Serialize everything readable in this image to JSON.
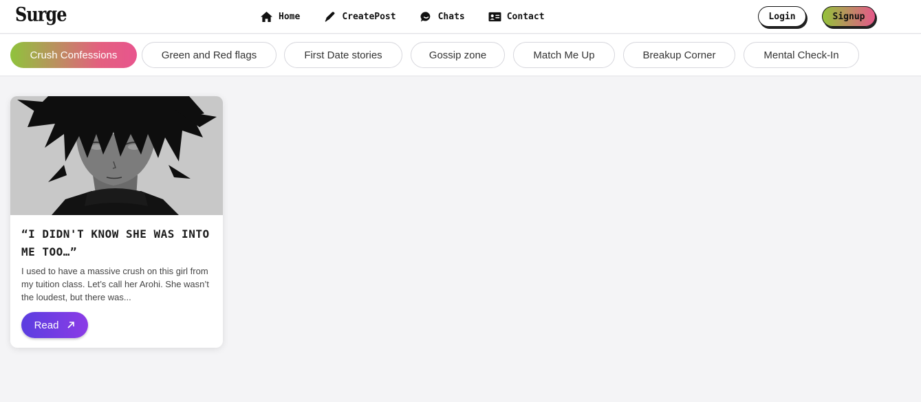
{
  "brand": {
    "name": "Surge"
  },
  "nav": {
    "links": [
      {
        "label": "Home",
        "icon": "home-icon"
      },
      {
        "label": "CreatePost",
        "icon": "pen-icon"
      },
      {
        "label": "Chats",
        "icon": "chat-icon"
      },
      {
        "label": "Contact",
        "icon": "contact-card-icon"
      }
    ],
    "login_label": "Login",
    "signup_label": "Signup"
  },
  "categories": [
    {
      "label": "Crush Confessions",
      "active": true
    },
    {
      "label": "Green and Red flags",
      "active": false
    },
    {
      "label": "First Date stories",
      "active": false
    },
    {
      "label": "Gossip zone",
      "active": false
    },
    {
      "label": "Match Me Up",
      "active": false
    },
    {
      "label": "Breakup Corner",
      "active": false
    },
    {
      "label": "Mental Check-In",
      "active": false
    }
  ],
  "posts": [
    {
      "title": "“I DIDN'T KNOW SHE WAS INTO ME TOO…”",
      "excerpt": "I used to have a massive crush on this girl from my tuition class. Let’s call her Arohi. She wasn’t the loudest, but there was...",
      "read_label": "Read",
      "image": "anime-boy-portrait"
    }
  ],
  "colors": {
    "active_gradient_start": "#8fc33c",
    "active_gradient_end": "#e8558e",
    "read_button_start": "#5b3ee0",
    "read_button_end": "#8b3ce6"
  }
}
